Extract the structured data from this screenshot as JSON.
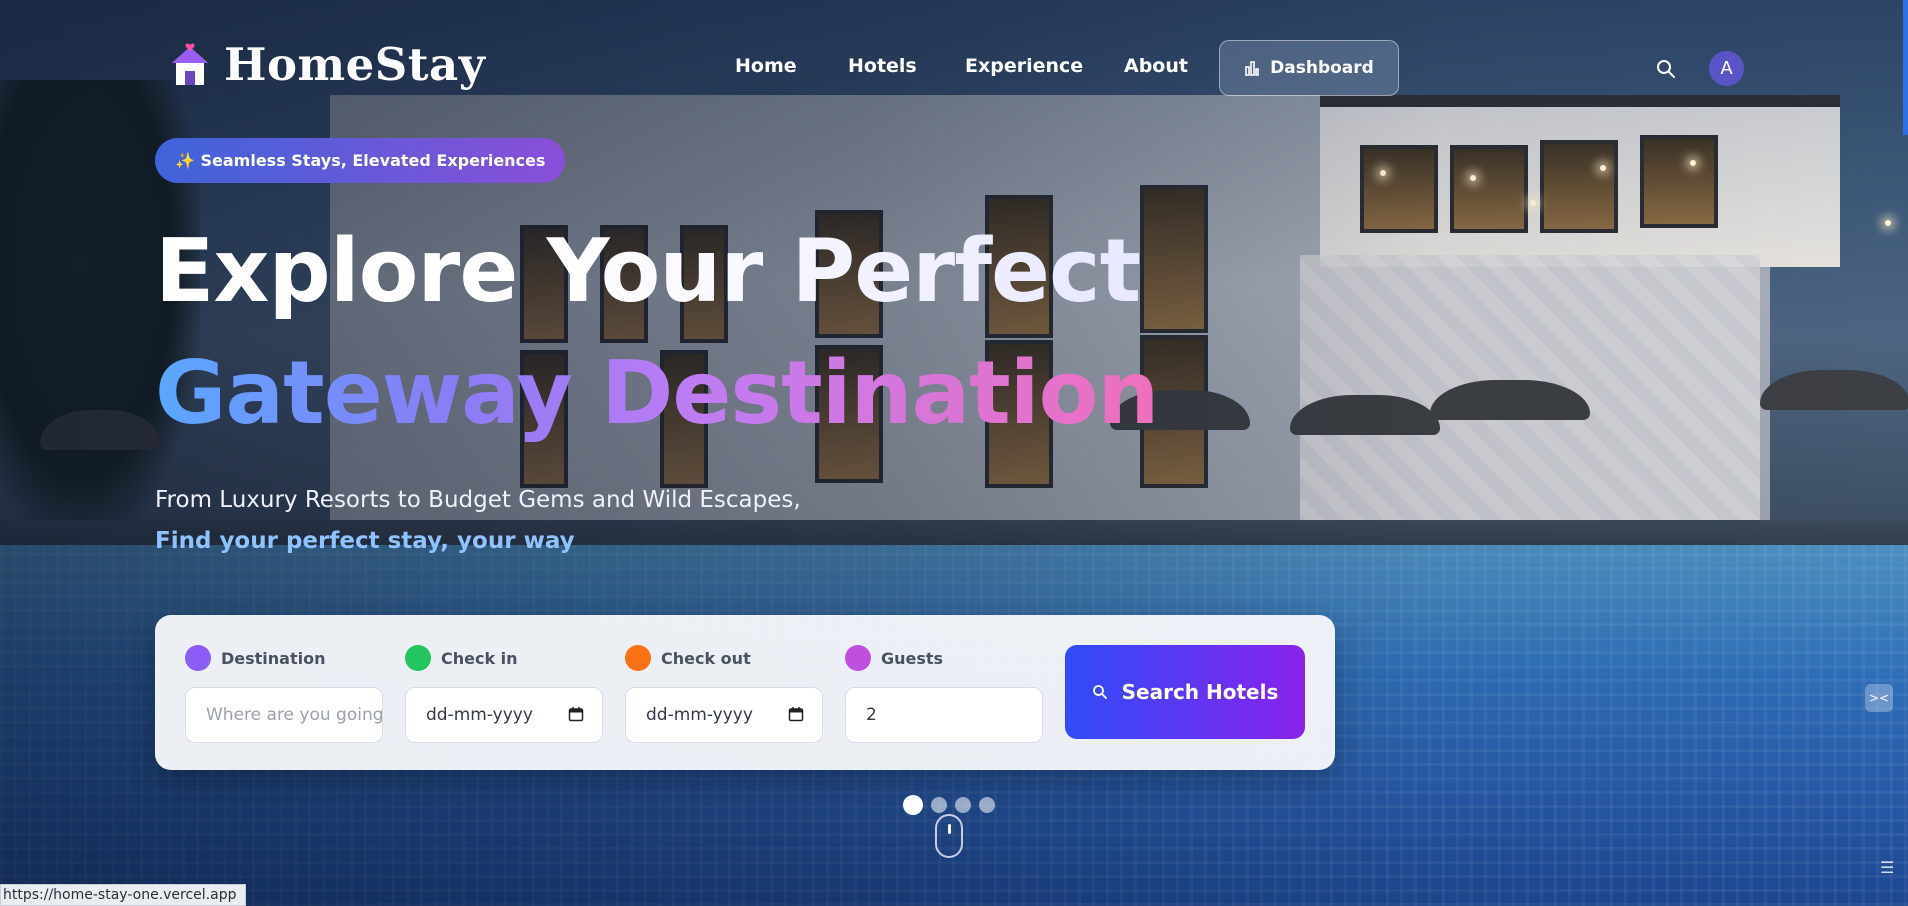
{
  "brand": {
    "name": "HomeStay"
  },
  "nav": {
    "links": [
      "Home",
      "Hotels",
      "Experience",
      "About"
    ],
    "dashboard_label": "Dashboard",
    "avatar_initial": "A"
  },
  "hero": {
    "badge": "✨ Seamless Stays, Elevated Experiences",
    "title_line1": "Explore Your Perfect",
    "title_line2": "Gateway Destination",
    "subtitle_line1": "From Luxury Resorts to Budget Gems and Wild Escapes,",
    "subtitle_line2": "Find your perfect stay, your way"
  },
  "search": {
    "destination": {
      "label": "Destination",
      "placeholder": "Where are you going?",
      "dot_color": "#8b5cf6"
    },
    "check_in": {
      "label": "Check in",
      "value": "dd-mm-yyyy",
      "dot_color": "#22c55e"
    },
    "check_out": {
      "label": "Check out",
      "value": "dd-mm-yyyy",
      "dot_color": "#f97316"
    },
    "guests": {
      "label": "Guests",
      "value": "2",
      "dot_color": "#c04fe0"
    },
    "button_label": "Search Hotels"
  },
  "carousel": {
    "slides": 4,
    "active_index": 0
  },
  "status_bar": {
    "url": "https://home-stay-one.vercel.app"
  },
  "colors": {
    "accent_start": "#2f4cf7",
    "accent_end": "#8a22ec",
    "subtitle_highlight": "#8fc3ff"
  }
}
